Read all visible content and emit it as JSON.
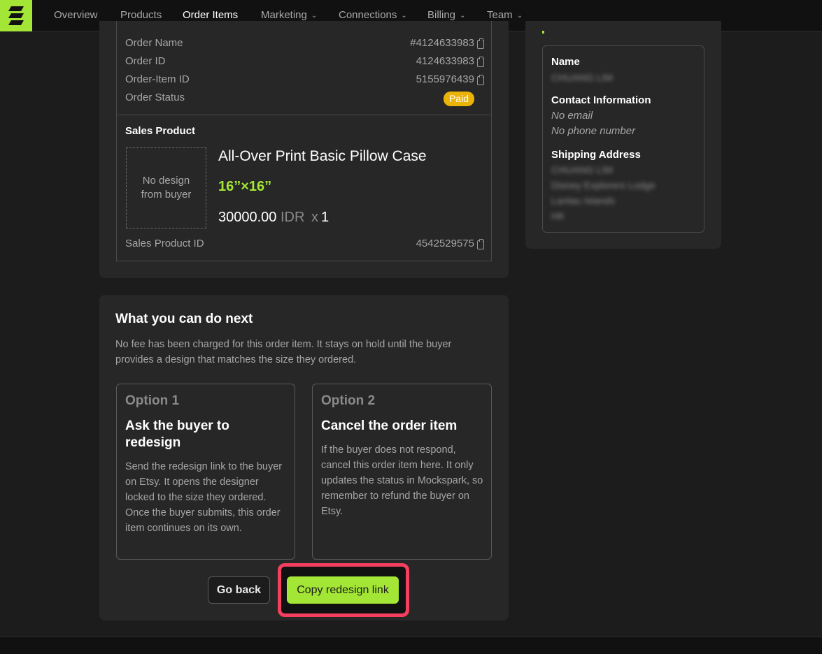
{
  "nav": {
    "items": [
      {
        "label": "Overview",
        "active": false,
        "dropdown": false
      },
      {
        "label": "Products",
        "active": false,
        "dropdown": false
      },
      {
        "label": "Order Items",
        "active": true,
        "dropdown": false
      },
      {
        "label": "Marketing",
        "active": false,
        "dropdown": true
      },
      {
        "label": "Connections",
        "active": false,
        "dropdown": true
      },
      {
        "label": "Billing",
        "active": false,
        "dropdown": true
      },
      {
        "label": "Team",
        "active": false,
        "dropdown": true
      }
    ],
    "chevron_icon": "chevron-down-icon"
  },
  "order": {
    "rows": [
      {
        "label": "Order Name",
        "value": "#4124633983"
      },
      {
        "label": "Order ID",
        "value": "4124633983"
      },
      {
        "label": "Order-Item ID",
        "value": "5155976439"
      },
      {
        "label": "Order Status",
        "value": "Paid"
      }
    ],
    "status_color": "#eab308",
    "copy_icon": "clipboard-icon"
  },
  "sales_product": {
    "title": "Sales Product",
    "no_design_text": "No design from buyer",
    "name": "All-Over Print Basic Pillow Case",
    "size": "16”×16”",
    "price": "30000.00",
    "currency": "IDR",
    "times": "x",
    "quantity": "1",
    "id_label": "Sales Product ID",
    "id_value": "4542529575"
  },
  "customer": {
    "name_label": "Name",
    "name_value": "CHUANG LIM",
    "contact_label": "Contact Information",
    "email": "No email",
    "phone": "No phone number",
    "shipping_label": "Shipping Address",
    "address_lines": [
      "CHUANG LIM",
      "Disney Explorers Lodge",
      "Lantau Islands",
      "HK"
    ]
  },
  "next": {
    "title": "What you can do next",
    "description": "No fee has been charged for this order item. It stays on hold until the buyer provides a design that matches the size they ordered.",
    "option1": {
      "number": "Option 1",
      "heading": "Ask the buyer to redesign",
      "body": "Send the redesign link to the buyer on Etsy. It opens the designer locked to the size they ordered. Once the buyer submits, this order item continues on its own."
    },
    "option2": {
      "number": "Option 2",
      "heading": "Cancel the order item",
      "body": "If the buyer does not respond, cancel this order item here. It only updates the status in Mockspark, so remember to refund the buyer on Etsy."
    },
    "back_label": "Go back",
    "copy_label": "Copy redesign link"
  },
  "colors": {
    "accent": "#a3e635",
    "highlight": "#f43f5e",
    "background": "#1c1c1c",
    "card": "#272727"
  }
}
